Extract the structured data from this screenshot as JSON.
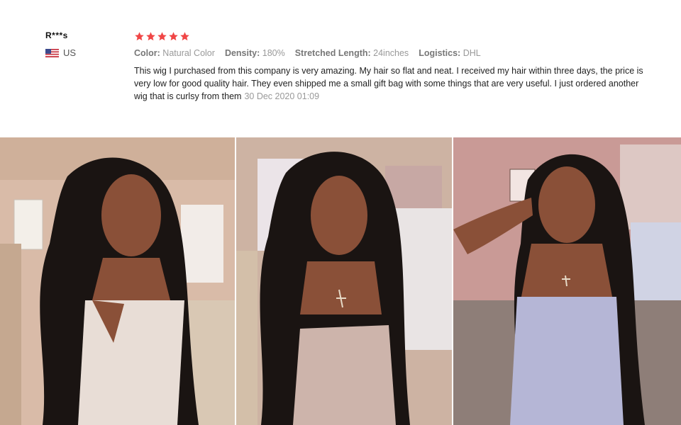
{
  "review": {
    "username": "R***s",
    "country": "US",
    "rating": 5,
    "attributes": [
      {
        "key": "Color:",
        "value": "Natural Color"
      },
      {
        "key": "Density:",
        "value": "180%"
      },
      {
        "key": "Stretched Length:",
        "value": "24inches"
      },
      {
        "key": "Logistics:",
        "value": "DHL"
      }
    ],
    "text": "This wig I purchased from this company is very amazing. My hair so flat and neat. I received my hair within three days, the price is very low for good quality hair. They even shipped me a small gift bag with some things that are very useful. I just ordered another wig that is curlsy from them",
    "date": "30 Dec 2020 01:09"
  },
  "colors": {
    "star": "#f04646",
    "wall_left": "#d8b8a4",
    "wall_mid": "#ccb0a0",
    "wall_right": "#c89a96",
    "skin": "#8a5038",
    "hair": "#1a1412",
    "top_left": "#e8ddd6",
    "top_mid": "#cdb4ab",
    "top_right": "#b5b6d6"
  },
  "photos": [
    {
      "name": "customer-photo-1",
      "scene": "left"
    },
    {
      "name": "customer-photo-2",
      "scene": "mid"
    },
    {
      "name": "customer-photo-3",
      "scene": "right"
    }
  ]
}
